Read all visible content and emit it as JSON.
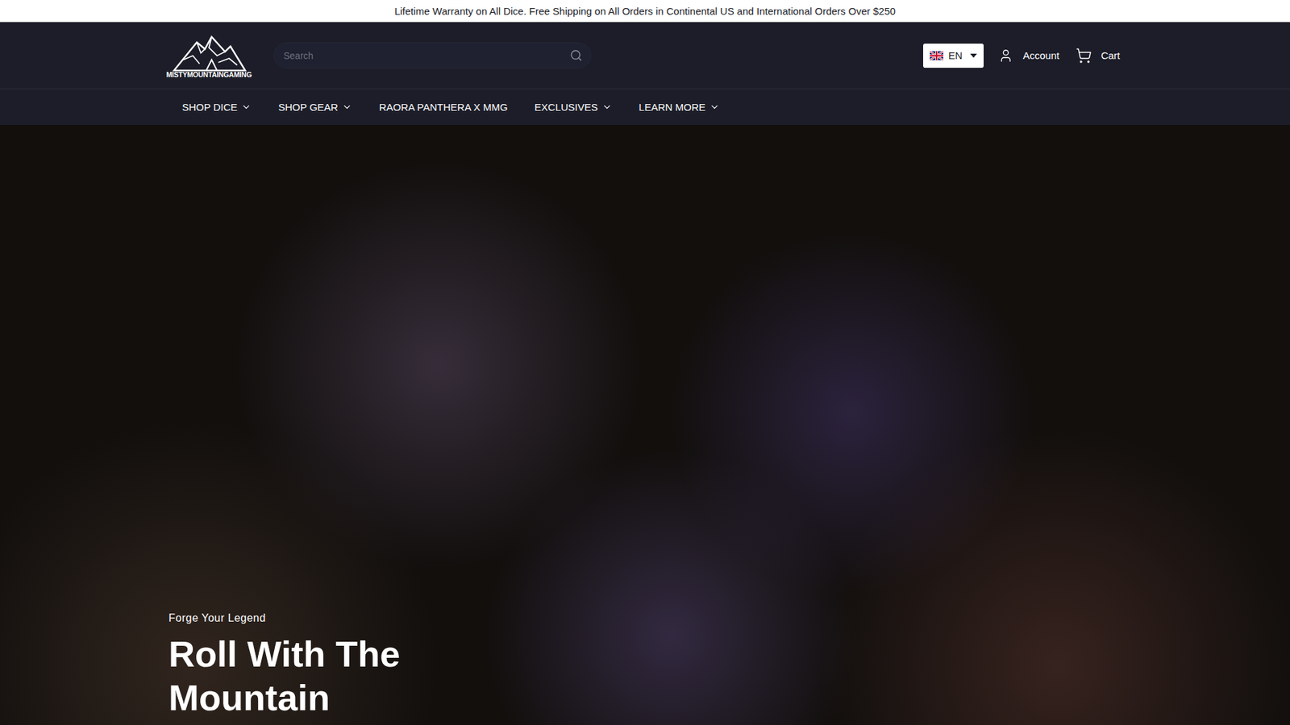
{
  "announcement": "Lifetime Warranty on All Dice. Free Shipping on All Orders in Continental US and International Orders Over $250",
  "logo": {
    "text": "MISTYMOUNTAINGAMING"
  },
  "search": {
    "placeholder": "Search"
  },
  "language": {
    "label": "EN"
  },
  "header_links": [
    {
      "label": "Account",
      "kind": "account"
    },
    {
      "label": "Cart",
      "kind": "cart"
    }
  ],
  "nav": [
    {
      "label": "SHOP DICE",
      "dropdown": true
    },
    {
      "label": "SHOP GEAR",
      "dropdown": true
    },
    {
      "label": "RAORA PANTHERA X MMG",
      "dropdown": false
    },
    {
      "label": "EXCLUSIVES",
      "dropdown": true
    },
    {
      "label": "LEARN MORE",
      "dropdown": true
    }
  ],
  "hero": {
    "eyebrow": "Forge Your Legend",
    "heading": "Roll With The Mountain"
  }
}
